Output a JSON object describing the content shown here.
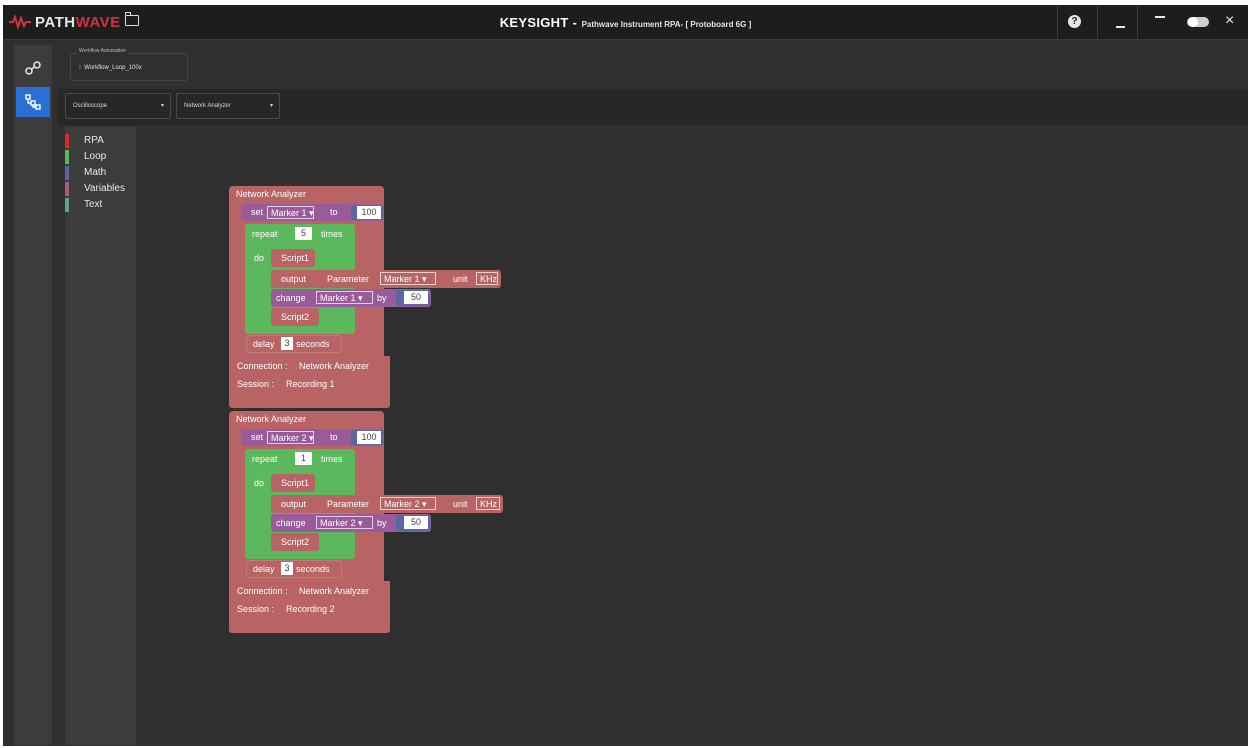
{
  "titlebar": {
    "logo_path": "PATH",
    "logo_wave": "WAVE",
    "brand": "KEYSIGHT -",
    "subtitle": "Pathwave Instrument RPA- [ Protoboard 6G ]",
    "help_glyph": "?",
    "close_glyph": "×"
  },
  "workflow": {
    "label": "Workflow Automation",
    "value": "Workflow_Loop_100x"
  },
  "toolbar": {
    "instrument_1": "Oscilloscope",
    "instrument_2": "Network Analyzer",
    "caret": "▾"
  },
  "categories": [
    {
      "label": "RPA",
      "color": "#d42a2a"
    },
    {
      "label": "Loop",
      "color": "#5cb85c"
    },
    {
      "label": "Math",
      "color": "#5b67a5"
    },
    {
      "label": "Variables",
      "color": "#a55b80"
    },
    {
      "label": "Text",
      "color": "#5ba58c"
    }
  ],
  "colors": {
    "rpa_block": "#b86464",
    "loop_block": "#5cb85c",
    "variable_block": "#9a5b9a",
    "math_block": "#5b67a5",
    "accent": "#2a6fd6"
  },
  "blocks": [
    {
      "header": "Network Analyzer",
      "set_kw": "set",
      "set_var": "Marker 1 ▾",
      "to_kw": "to",
      "set_value": "100",
      "repeat_kw": "repeat",
      "repeat_count": "5",
      "times_kw": "times",
      "do_kw": "do",
      "script1": "Script1",
      "output_kw": "output",
      "param_kw": "Parameter",
      "param_value": "Marker 1 ▾",
      "unit_kw": "unit",
      "unit_value": "KHz",
      "change_kw": "change",
      "change_var": "Marker 1 ▾",
      "by_kw": "by",
      "change_value": "50",
      "script2": "Script2",
      "delay_kw": "delay",
      "delay_value": "3",
      "seconds_kw": "seconds",
      "connection_label": "Connection :",
      "connection_value": "Network Analyzer",
      "session_label": "Session :",
      "session_value": "Recording 1"
    },
    {
      "header": "Network Analyzer",
      "set_kw": "set",
      "set_var": "Marker 2 ▾",
      "to_kw": "to",
      "set_value": "100",
      "repeat_kw": "repeat",
      "repeat_count": "1",
      "times_kw": "times",
      "do_kw": "do",
      "script1": "Script1",
      "output_kw": "output",
      "param_kw": "Parameter",
      "param_value": "Marker 2 ▾",
      "unit_kw": "unit",
      "unit_value": "KHz",
      "change_kw": "change",
      "change_var": "Marker 2 ▾",
      "by_kw": "by",
      "change_value": "50",
      "script2": "Script2",
      "delay_kw": "delay",
      "delay_value": "3",
      "seconds_kw": "seconds",
      "connection_label": "Connection :",
      "connection_value": "Network Analyzer",
      "session_label": "Session :",
      "session_value": "Recording 2"
    }
  ]
}
